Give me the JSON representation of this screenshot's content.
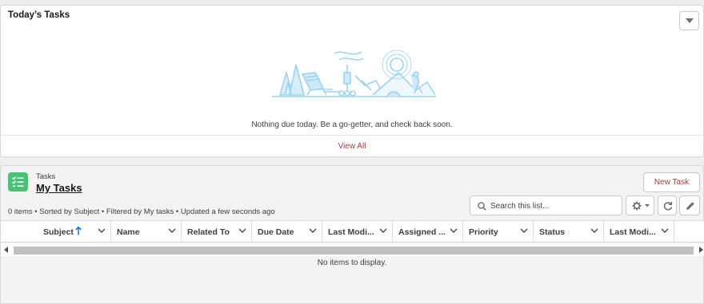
{
  "today_card": {
    "title": "Today’s Tasks",
    "empty_message": "Nothing due today. Be a go-getter, and check back soon.",
    "view_all": "View All",
    "menu_icon": "chevron-down-icon"
  },
  "list_view": {
    "object_label": "Tasks",
    "view_name": "My Tasks",
    "object_icon": "task-list-icon",
    "new_button": "New Task",
    "meta": "0 items • Sorted by Subject • Filtered by My tasks • Updated a few seconds ago",
    "search_placeholder": "Search this list...",
    "columns": [
      "Subject",
      "Name",
      "Related To",
      "Due Date",
      "Last Modi...",
      "Assigned ...",
      "Priority",
      "Status",
      "Last Modi..."
    ],
    "sort_column": "Subject",
    "sort_direction": "ascending",
    "empty_message": "No items to display."
  },
  "colors": {
    "brand_link": "#a13b3b",
    "task_icon_bg": "#4bc076",
    "illustration": "#9bd4f2"
  }
}
